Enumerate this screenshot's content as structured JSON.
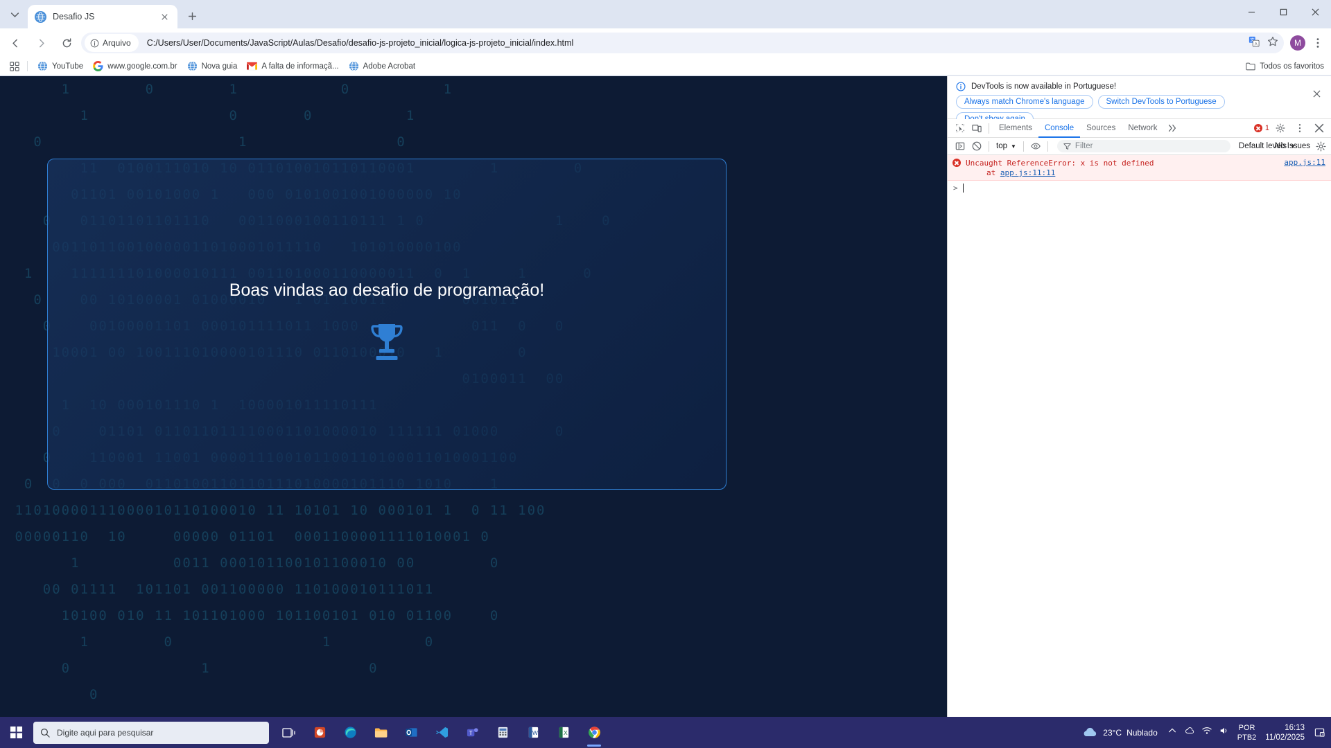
{
  "window": {
    "minimize_label": "Minimize",
    "maximize_label": "Maximize",
    "close_label": "Close"
  },
  "tabstrip": {
    "tab_search_label": "Search tabs",
    "new_tab_label": "New tab",
    "tabs": [
      {
        "title": "Desafio JS",
        "favicon": "globe-icon",
        "close_label": "Close tab"
      }
    ]
  },
  "toolbar": {
    "back_label": "Back",
    "forward_label": "Forward",
    "reload_label": "Reload",
    "security_chip": "Arquivo",
    "url": "C:/Users/User/Documents/JavaScript/Aulas/Desafio/desafio-js-projeto_inicial/logica-js-projeto_inicial/index.html",
    "translate_label": "Translate",
    "bookmark_label": "Bookmark this tab",
    "profile_initial": "M",
    "menu_label": "Customize and control Google Chrome"
  },
  "bookmarks": {
    "apps_label": "Apps",
    "items": [
      {
        "label": "YouTube",
        "icon": "globe-icon"
      },
      {
        "label": "www.google.com.br",
        "icon": "google-g-icon"
      },
      {
        "label": "Nova guia",
        "icon": "globe-icon"
      },
      {
        "label": "A falta de informaçã...",
        "icon": "gmail-icon"
      },
      {
        "label": "Adobe Acrobat",
        "icon": "globe-icon"
      }
    ],
    "all_bookmarks": "Todos os favoritos",
    "all_bookmarks_icon": "folder-icon"
  },
  "page": {
    "welcome_text": "Boas vindas ao desafio de programação!",
    "trophy_icon": "trophy-icon",
    "background_rows": [
      "      1        0        1           0          1",
      "        1               0       0          1",
      "   0                     1                0",
      "        11  0100111010 10 011010010110110001        1        0",
      "       01101 00101000 1   000 0101001001000000 10",
      "    0   01101101101110   0011000100110111 1 0              1    0",
      "     00110110010000011010001011110   101010000100",
      "  1    111111101000010111 001101000110000011  0  1     1      0",
      "   0    00 10100001 01000010   1 01 10011        001011",
      "    0    00100001101 000101111011 1000            011  0   0",
      "     10001 00 100111010000101110 0110100010   1        0",
      "                                                 0100011  00",
      "      1  10 000101110 1  100001011110111",
      "     0    01101 011011011110001101000010 111111 01000      0",
      "    0    110001 11001 000011100101100110100011010001100",
      "  0  0  0 000  0110100110110111010000101110 1010    1",
      " 11010000111000010110100010 11 10101 10 000101 1  0 11 100",
      " 00000110  10     00000 01101  0001100001111010001 0",
      "       1          0011 000101100101100010 00        0",
      "    00 01111  101101 001100000 110100010111011",
      "      10100 010 11 101101000 101100101 010 01100    0",
      "        1        0                1          0",
      "      0              1                 0",
      "         0"
    ]
  },
  "devtools": {
    "notice": {
      "icon": "info-icon",
      "message": "DevTools is now available in Portuguese!",
      "buttons": [
        "Always match Chrome's language",
        "Switch DevTools to Portuguese",
        "Don't show again"
      ],
      "close_label": "Close"
    },
    "toolbar": {
      "inspect_label": "Inspect element",
      "device_toolbar_label": "Toggle device toolbar",
      "tabs": [
        {
          "label": "Elements",
          "active": false
        },
        {
          "label": "Console",
          "active": true
        },
        {
          "label": "Sources",
          "active": false
        },
        {
          "label": "Network",
          "active": false
        }
      ],
      "more_tabs_label": "More tabs",
      "error_count": "1",
      "settings_label": "Settings",
      "more_options_label": "Customize and control DevTools",
      "close_label": "Close DevTools"
    },
    "console": {
      "sidebar_label": "Show console sidebar",
      "clear_label": "Clear console",
      "context": "top",
      "eye_label": "Create live expression",
      "filter_placeholder": "Filter",
      "levels": "Default levels",
      "issues": "No Issues",
      "settings_label": "Console settings",
      "messages": [
        {
          "type": "error",
          "text": "Uncaught ReferenceError: x is not defined",
          "at_prefix": "at ",
          "at_link": "app.js:11:11",
          "source_link": "app.js:11"
        }
      ],
      "prompt_symbol": ">"
    }
  },
  "taskbar": {
    "start_label": "Start",
    "search_placeholder": "Digite aqui para pesquisar",
    "search_icon": "search-icon",
    "apps": [
      {
        "name": "task-view-icon"
      },
      {
        "name": "powerpoint-icon"
      },
      {
        "name": "edge-icon"
      },
      {
        "name": "file-explorer-icon"
      },
      {
        "name": "outlook-icon"
      },
      {
        "name": "vscode-icon"
      },
      {
        "name": "teams-icon"
      },
      {
        "name": "calculator-icon"
      },
      {
        "name": "word-icon"
      },
      {
        "name": "excel-icon"
      },
      {
        "name": "chrome-icon"
      }
    ],
    "weather": {
      "icon": "cloud-icon",
      "temperature": "23°C",
      "condition": "Nublado"
    },
    "tray": [
      "chevron-up-icon",
      "onedrive-icon",
      "network-icon",
      "volume-icon"
    ],
    "language": {
      "line1": "POR",
      "line2": "PTB2"
    },
    "clock": {
      "time": "16:13",
      "date": "11/02/2025"
    },
    "notifications_label": "Notifications"
  }
}
